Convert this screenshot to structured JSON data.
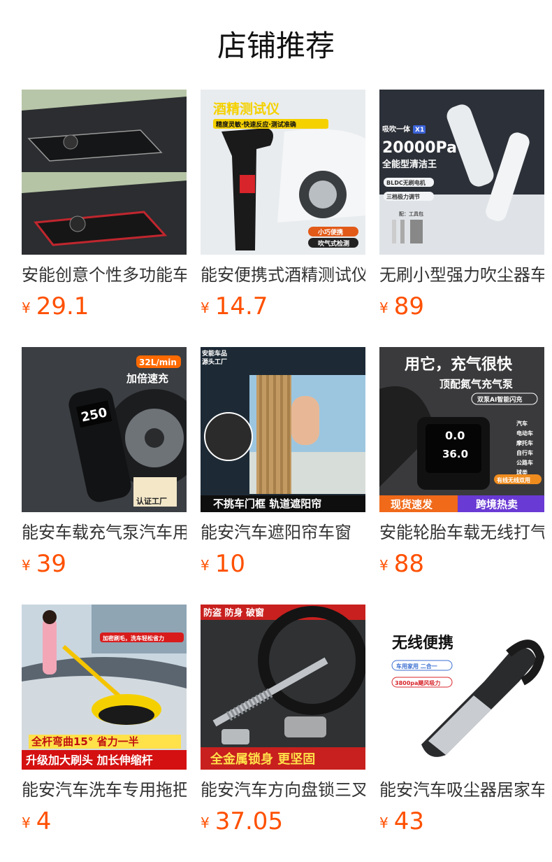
{
  "header": {
    "title": "店铺推荐"
  },
  "currency_symbol": "¥",
  "products": [
    {
      "name": "安能创意个性多功能车载防滑垫",
      "price": "29.1",
      "image": {
        "overlay": []
      }
    },
    {
      "name": "能安便携式酒精测试仪",
      "price": "14.7",
      "image": {
        "overlay": [
          "酒精测试仪",
          "精度灵敏·快速反应·测试准确",
          "小巧便携",
          "吹气式检测"
        ]
      }
    },
    {
      "name": "无刷小型强力吹尘器车载",
      "price": "89",
      "image": {
        "overlay": [
          "吸吹一体",
          "X1",
          "20000Pa",
          "全能型清洁王",
          "BLDC无刷电机",
          "三档极力调节",
          "配：工具包"
        ]
      }
    },
    {
      "name": "能安车载充气泵汽车用",
      "price": "39",
      "image": {
        "overlay": [
          "32L/min",
          "加倍速充",
          "250",
          "认证工厂"
        ]
      }
    },
    {
      "name": "能安汽车遮阳帘车窗",
      "price": "10",
      "image": {
        "overlay": [
          "安能车品",
          "源头工厂",
          "不挑车门框 轨道遮阳帘"
        ]
      }
    },
    {
      "name": "安能轮胎车载无线打气泵",
      "price": "88",
      "image": {
        "overlay": [
          "用它，充气很快",
          "顶配氮气充气泵",
          "双泵AI智能闪充",
          "0.0",
          "36.0",
          "汽车",
          "电动车",
          "摩托车",
          "自行车",
          "公路车",
          "球类",
          "有线无线双用",
          "现货速发",
          "跨境热卖"
        ]
      }
    },
    {
      "name": "能安汽车洗车专用拖把",
      "price": "4",
      "image": {
        "overlay": [
          "加密刷毛，洗车轻松省力",
          "全杆弯曲15° 省力一半",
          "升级加大刷头 加长伸缩杆"
        ]
      }
    },
    {
      "name": "能安汽车方向盘锁三叉",
      "price": "37.05",
      "image": {
        "overlay": [
          "防盗 防身 破窗",
          "全金属锁身 更坚固"
        ]
      }
    },
    {
      "name": "能安汽车吸尘器居家车用",
      "price": "43",
      "image": {
        "overlay": [
          "无线便携",
          "车用家用 二合一",
          "3800pa飓风吸力"
        ]
      }
    }
  ]
}
